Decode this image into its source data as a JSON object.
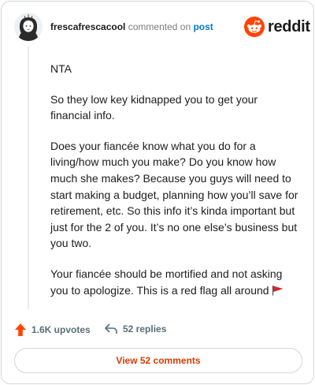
{
  "comment": {
    "author": "frescafrescacool",
    "action_text": "commented on",
    "post_link": "post",
    "brand": "reddit",
    "paragraphs": [
      "NTA",
      "So they low key kidnapped you to get your financial info.",
      "Does your fiancée know what you do for a living/how much you make? Do you know how much she makes? Because you guys will need to start making a budget, planning how you’ll save for retirement, etc. So this info it’s kinda important but just for the 2 of you. It’s no one else’s business but you two.",
      "Your fiancée should be mortified and not asking you to apologize. This is a red flag all around"
    ],
    "icons": {
      "flag": "red-flag-emoji",
      "upvote": "upvote-arrow-icon",
      "reply": "reply-arrow-icon",
      "logo": "reddit-snoo-icon"
    }
  },
  "footer": {
    "upvotes": "1.6K upvotes",
    "replies": "52 replies",
    "view_comments": "View 52 comments"
  },
  "colors": {
    "brand_orange": "#ff4500",
    "link_blue": "#0079d3",
    "cta_text": "#d93a00",
    "muted_gray": "#576f76"
  }
}
